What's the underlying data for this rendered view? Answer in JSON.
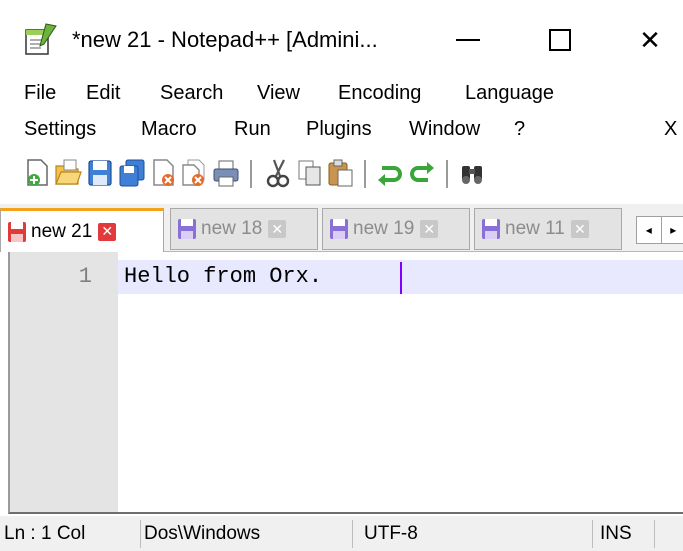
{
  "window": {
    "title": "*new 21 - Notepad++ [Admini...",
    "minimize_icon": "minimize-icon",
    "maximize_icon": "maximize-icon",
    "close_glyph": "✕"
  },
  "menu": {
    "row1": [
      {
        "label": "File"
      },
      {
        "label": "Edit"
      },
      {
        "label": "Search"
      },
      {
        "label": "View"
      },
      {
        "label": "Encoding"
      },
      {
        "label": "Language"
      }
    ],
    "row2": [
      {
        "label": "Settings"
      },
      {
        "label": "Macro"
      },
      {
        "label": "Run"
      },
      {
        "label": "Plugins"
      },
      {
        "label": "Window"
      },
      {
        "label": "?"
      },
      {
        "label": "X"
      }
    ]
  },
  "toolbar": {
    "icons": [
      "new-file-icon",
      "open-file-icon",
      "save-icon",
      "save-all-icon",
      "close-icon",
      "close-all-icon",
      "print-icon",
      "cut-icon",
      "copy-icon",
      "paste-icon",
      "undo-icon",
      "redo-icon",
      "find-icon"
    ]
  },
  "tabs": [
    {
      "label": "new 21",
      "active": true
    },
    {
      "label": "new 18",
      "active": false
    },
    {
      "label": "new 19",
      "active": false
    },
    {
      "label": "new 11",
      "active": false
    }
  ],
  "tab_scroll": {
    "left": "◂",
    "right": "▸"
  },
  "editor": {
    "lines": [
      {
        "number": "1",
        "text": "Hello from Orx."
      }
    ]
  },
  "statusbar": {
    "position": "Ln : 1    Col",
    "eol": "Dos\\Windows",
    "encoding": "UTF-8",
    "mode": "INS"
  },
  "colors": {
    "active_tab_accent": "#f3a21b",
    "tab_close_active": "#e23a3a",
    "current_line": "#e8e8ff",
    "caret": "#8000ff",
    "disk_active": "#e03a3a",
    "disk_inactive": "#8a6fd6"
  }
}
